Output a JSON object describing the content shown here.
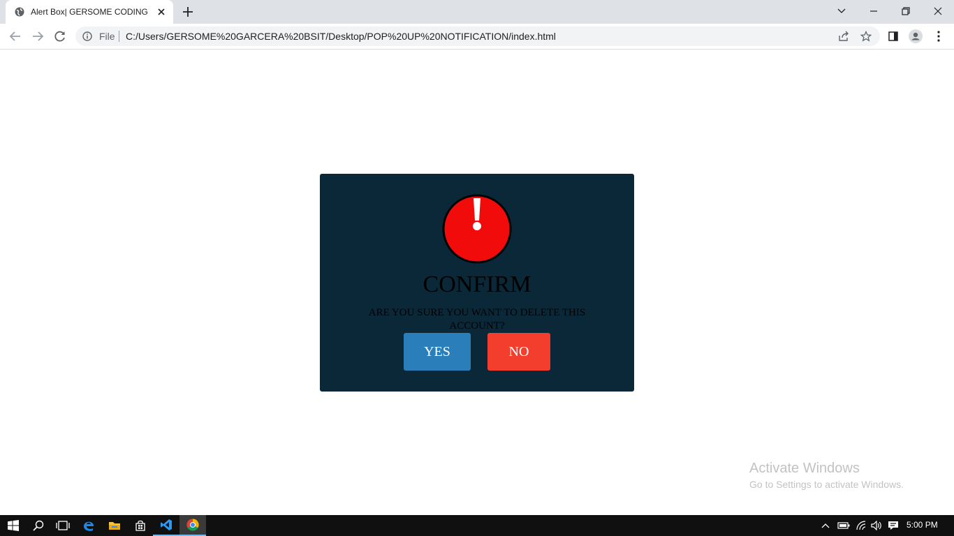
{
  "browser": {
    "tab_title": "Alert Box| GERSOME CODING",
    "omnibox": {
      "scheme_label": "File",
      "url": "C:/Users/GERSOME%20GARCERA%20BSIT/Desktop/POP%20UP%20NOTIFICATION/index.html"
    },
    "toolbar_icons": [
      "back-icon",
      "forward-icon",
      "reload-icon",
      "info-icon",
      "share-icon",
      "star-icon",
      "side-panel-icon",
      "profile-icon",
      "menu-icon"
    ],
    "window_controls": [
      "chevron-down-icon",
      "minimize-icon",
      "restore-icon",
      "close-icon"
    ]
  },
  "modal": {
    "title": "CONFIRM",
    "message": "ARE YOU SURE YOU WANT TO DELETE THIS ACCOUNT?",
    "yes_label": "YES",
    "no_label": "NO",
    "colors": {
      "background": "#0b2838",
      "icon_red": "#f20b0b",
      "yes": "#2a7fba",
      "no": "#f33e2d"
    }
  },
  "watermark": {
    "title": "Activate Windows",
    "subtitle": "Go to Settings to activate Windows."
  },
  "taskbar": {
    "apps": [
      "windows-start-icon",
      "search-icon",
      "task-view-icon",
      "edge-icon",
      "file-explorer-icon",
      "store-icon",
      "vscode-icon",
      "chrome-icon"
    ],
    "time": "5:00 PM"
  }
}
